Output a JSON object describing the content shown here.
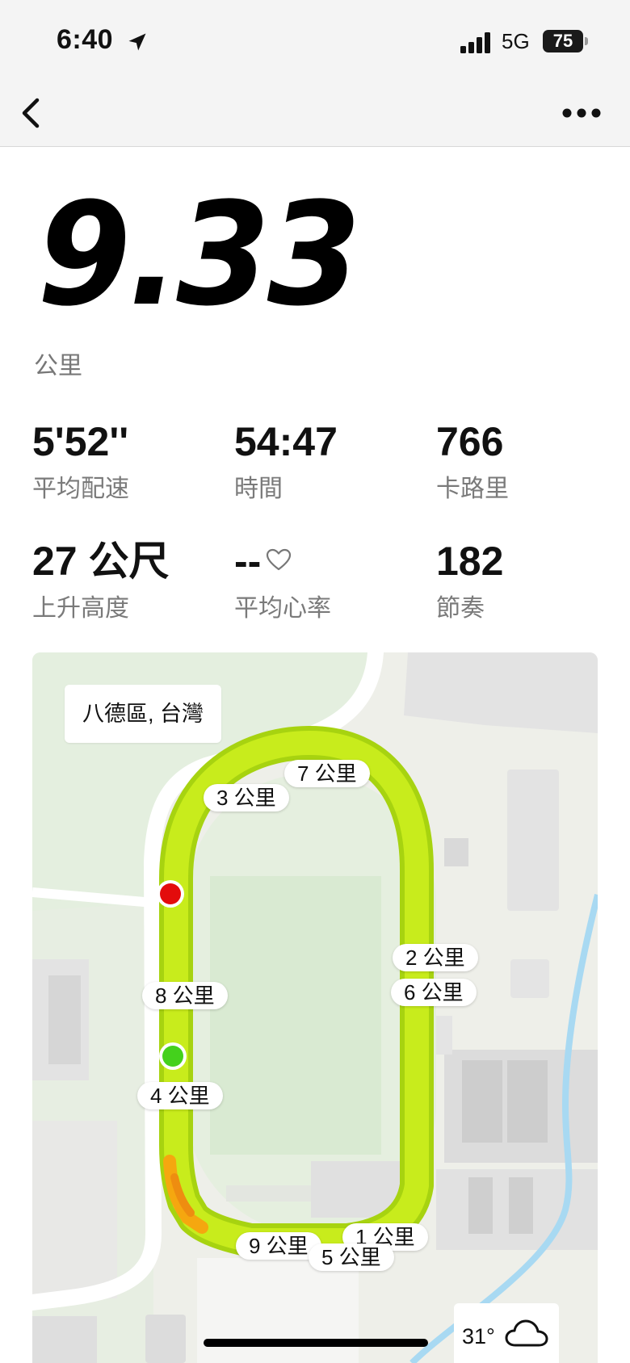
{
  "status_bar": {
    "time": "6:40",
    "network": "5G",
    "battery": "75"
  },
  "nav": {
    "back_icon": "chevron-left-icon",
    "more_icon": "ellipsis-icon"
  },
  "summary": {
    "distance": "9.33",
    "distance_unit": "公里"
  },
  "stats": [
    {
      "value": "5'52''",
      "label": "平均配速"
    },
    {
      "value": "54:47",
      "label": "時間"
    },
    {
      "value": "766",
      "label": "卡路里"
    },
    {
      "value": "27 公尺",
      "label": "上升高度"
    },
    {
      "value": "--",
      "label": "平均心率"
    },
    {
      "value": "182",
      "label": "節奏"
    }
  ],
  "map": {
    "location": "八德區, 台灣",
    "route_color": "#c8ec1c",
    "start_color": "#44d11c",
    "end_color": "#e30c0c",
    "km_labels": [
      "7 公里",
      "3 公里",
      "2 公里",
      "6 公里",
      "8 公里",
      "4 公里",
      "9 公里",
      "1 公里",
      "5 公里"
    ],
    "weather_temp": "31°",
    "weather_icon": "cloud-icon"
  }
}
